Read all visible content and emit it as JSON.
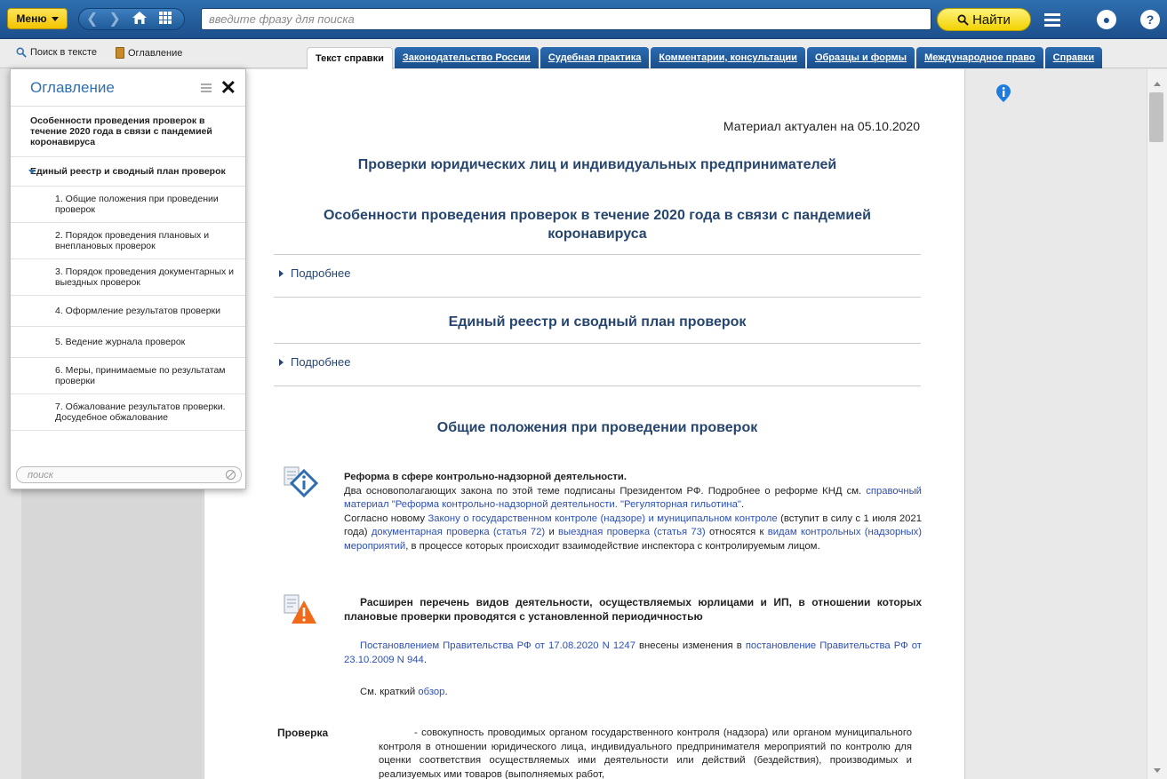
{
  "topbar": {
    "menu_label": "Меню",
    "search_placeholder": "введите фразу для поиска",
    "find_label": "Найти"
  },
  "subbar": {
    "search_in_text": "Поиск в тексте",
    "contents": "Оглавление"
  },
  "tabs": [
    {
      "label": "Текст справки",
      "active": true
    },
    {
      "label": "Законодательство России"
    },
    {
      "label": "Судебная практика"
    },
    {
      "label": "Комментарии, консультации"
    },
    {
      "label": "Образцы и формы"
    },
    {
      "label": "Международное право"
    },
    {
      "label": "Справки"
    }
  ],
  "toc": {
    "title": "Оглавление",
    "items": [
      "Особенности проведения проверок в течение 2020 года в связи с пандемией коронавируса",
      "Единый реестр и сводный план проверок",
      "1. Общие положения при проведении проверок",
      "2. Порядок проведения плановых и внеплановых проверок",
      "3. Порядок проведения документарных и выездных проверок",
      "4. Оформление результатов проверки",
      "5. Ведение журнала проверок",
      "6. Меры, принимаемые по результатам проверки",
      "7. Обжалование результатов проверки. Досудебное обжалование"
    ],
    "search_placeholder": "поиск"
  },
  "doc": {
    "actual": "Материал актуален на 05.10.2020",
    "h1": "Проверки юридических лиц и индивидуальных предпринимателей",
    "h2": "Особенности проведения проверок в течение 2020 года в связи с пандемией коронавируса",
    "more": "Подробнее",
    "h3": "Единый реестр и сводный план проверок",
    "h4": "Общие положения при проведении проверок",
    "note1": {
      "title": "Реформа в сфере контрольно-надзорной деятельности.",
      "t1": "Два основополагающих закона по этой теме подписаны Президентом РФ. Подробнее о реформе КНД см. ",
      "l1": "справочный материал \"Реформа контрольно-надзорной деятельности. \"Регуляторная гильотина\"",
      "t2": ".",
      "t3": "Согласно новому ",
      "l2": "Закону о государственном контроле (надзоре) и муниципальном контроле",
      "t4": " (вступит в силу с 1 июля 2021 года) ",
      "l3": "документарная проверка (статья 72)",
      "t5": " и ",
      "l4": "выездная проверка (статья 73)",
      "t6": " относятся к ",
      "l5": "видам контрольных (надзорных) мероприятий",
      "t7": ", в процессе которых происходит взаимодействие инспектора с контролируемым лицом."
    },
    "note2": {
      "title": "Расширен перечень видов деятельности, осуществляемых юрлицами и ИП, в отношении которых плановые проверки проводятся с установленной периодичностью"
    },
    "p_decree": {
      "l1": "Постановлением Правительства РФ от 17.08.2020 N 1247",
      "t1": " внесены изменения в ",
      "l2": "постановление Правительства РФ от 23.10.2009 N 944",
      "t2": "."
    },
    "p_see": {
      "t1": "См. краткий ",
      "l1": "обзор",
      "t2": "."
    },
    "def_term": "Проверка",
    "def_text": "- совокупность проводимых органом государственного контроля (надзора) или органом муниципального контроля в отношении юридического лица, индивидуального предпринимателя мероприятий по контролю для оценки соответствия осуществляемых ими деятельности или действий (бездействия), производимых и реализуемых ими товаров (выполняемых работ,"
  },
  "colors": {
    "brand_blue": "#1c4f8c",
    "accent_yellow": "#f2c400",
    "link": "#2b4fb5",
    "heading": "#27466f"
  },
  "icons": [
    "back-arrow-icon",
    "forward-arrow-icon",
    "home-icon",
    "grid-icon",
    "search-icon",
    "hamburger-icon",
    "user-icon",
    "help-icon",
    "book-icon",
    "info-icon",
    "close-icon",
    "list-icon",
    "clear-icon"
  ]
}
